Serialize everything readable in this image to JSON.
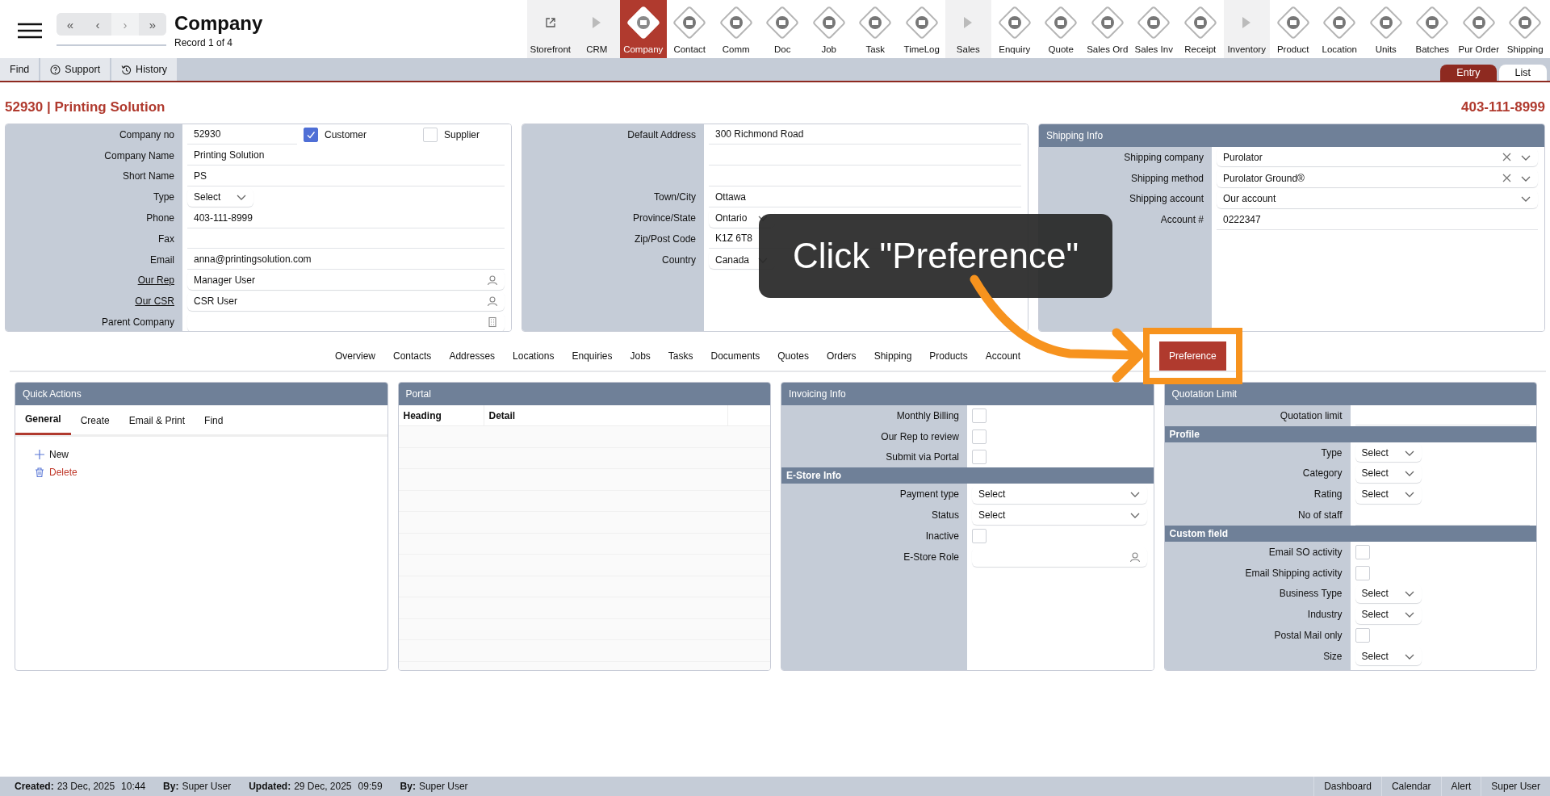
{
  "header": {
    "title": "Company",
    "subtitle": "Record 1 of 4",
    "nav": [
      {
        "glyph": "«",
        "disabled": false
      },
      {
        "glyph": "‹",
        "disabled": false
      },
      {
        "glyph": "›",
        "disabled": true
      },
      {
        "glyph": "»",
        "disabled": false
      }
    ]
  },
  "modules": [
    {
      "label": "Storefront",
      "kind": "link",
      "selected": false
    },
    {
      "label": "CRM",
      "kind": "section",
      "selected": false
    },
    {
      "label": "Company",
      "kind": "module",
      "selected": true
    },
    {
      "label": "Contact",
      "kind": "module",
      "selected": false
    },
    {
      "label": "Comm",
      "kind": "module",
      "selected": false
    },
    {
      "label": "Doc",
      "kind": "module",
      "selected": false
    },
    {
      "label": "Job",
      "kind": "module",
      "selected": false
    },
    {
      "label": "Task",
      "kind": "module",
      "selected": false
    },
    {
      "label": "TimeLog",
      "kind": "module",
      "selected": false
    },
    {
      "label": "Sales",
      "kind": "section",
      "selected": false
    },
    {
      "label": "Enquiry",
      "kind": "module",
      "selected": false
    },
    {
      "label": "Quote",
      "kind": "module",
      "selected": false
    },
    {
      "label": "Sales Ord",
      "kind": "module",
      "selected": false
    },
    {
      "label": "Sales Inv",
      "kind": "module",
      "selected": false
    },
    {
      "label": "Receipt",
      "kind": "module",
      "selected": false
    },
    {
      "label": "Inventory",
      "kind": "section",
      "selected": false
    },
    {
      "label": "Product",
      "kind": "module",
      "selected": false
    },
    {
      "label": "Location",
      "kind": "module",
      "selected": false
    },
    {
      "label": "Units",
      "kind": "module",
      "selected": false
    },
    {
      "label": "Batches",
      "kind": "module",
      "selected": false
    },
    {
      "label": "Pur Order",
      "kind": "module",
      "selected": false
    },
    {
      "label": "Shipping",
      "kind": "module",
      "selected": false
    }
  ],
  "toolbar": {
    "tools": [
      {
        "label": "Find",
        "kind": "plain"
      },
      {
        "label": "Support",
        "kind": "help"
      },
      {
        "label": "History",
        "kind": "history"
      }
    ],
    "views": [
      {
        "label": "Entry",
        "selected": true
      },
      {
        "label": "List",
        "selected": false
      }
    ]
  },
  "record": {
    "title": "52930 | Printing Solution",
    "phone": "403-111-8999"
  },
  "company_panel": {
    "rows": [
      {
        "label": "Company no",
        "kind": "checks",
        "value": "52930",
        "checks": [
          {
            "label": "Customer",
            "checked": true
          },
          {
            "label": "Supplier",
            "checked": false
          }
        ]
      },
      {
        "label": "Company Name",
        "kind": "text",
        "value": "Printing Solution"
      },
      {
        "label": "Short Name",
        "kind": "text",
        "value": "PS"
      },
      {
        "label": "Type",
        "kind": "select",
        "value": "Select"
      },
      {
        "label": "Phone",
        "kind": "text",
        "value": "403-111-8999"
      },
      {
        "label": "Fax",
        "kind": "text"
      },
      {
        "label": "Email",
        "kind": "text",
        "value": "anna@printingsolution.com"
      },
      {
        "label": "Our Rep",
        "kind": "user_lookup",
        "value": "Manager User",
        "link": true
      },
      {
        "label": "Our CSR",
        "kind": "user_lookup",
        "value": "CSR User",
        "link": true
      },
      {
        "label": "Parent Company",
        "kind": "company_lookup"
      }
    ]
  },
  "address_panel": {
    "rows": [
      {
        "label": "Default Address",
        "kind": "text",
        "value": "300 Richmond Road"
      },
      {
        "kind": "text"
      },
      {
        "kind": "text"
      },
      {
        "label": "Town/City",
        "kind": "text",
        "value": "Ottawa"
      },
      {
        "label": "Province/State",
        "kind": "select",
        "value": "Ontario"
      },
      {
        "label": "Zip/Post Code",
        "kind": "text",
        "value": "K1Z 6T8"
      },
      {
        "label": "Country",
        "kind": "select",
        "value": "Canada"
      }
    ]
  },
  "shipping_panel": {
    "title": "Shipping Info",
    "rows": [
      {
        "label": "Shipping company",
        "kind": "combo",
        "value": "Purolator",
        "clearable": true
      },
      {
        "label": "Shipping method",
        "kind": "combo",
        "value": "Purolator Ground®",
        "clearable": true
      },
      {
        "label": "Shipping account",
        "kind": "combo",
        "value": "Our account",
        "clearable": false
      },
      {
        "label": "Account #",
        "kind": "text",
        "value": "0222347"
      }
    ]
  },
  "record_tabs": [
    {
      "label": "Overview",
      "selected": false
    },
    {
      "label": "Contacts",
      "selected": false
    },
    {
      "label": "Addresses",
      "selected": false
    },
    {
      "label": "Locations",
      "selected": false
    },
    {
      "label": "Enquiries",
      "selected": false
    },
    {
      "label": "Jobs",
      "selected": false
    },
    {
      "label": "Tasks",
      "selected": false
    },
    {
      "label": "Documents",
      "selected": false
    },
    {
      "label": "Quotes",
      "selected": false
    },
    {
      "label": "Orders",
      "selected": false
    },
    {
      "label": "Shipping",
      "selected": false
    },
    {
      "label": "Products",
      "selected": false
    },
    {
      "label": "Account",
      "selected": false
    },
    {
      "label": "Preference",
      "selected": true
    }
  ],
  "quick_actions": {
    "title": "Quick Actions",
    "tabs": [
      {
        "label": "General",
        "selected": true
      },
      {
        "label": "Create",
        "selected": false
      },
      {
        "label": "Email & Print",
        "selected": false
      },
      {
        "label": "Find",
        "selected": false
      }
    ],
    "actions": [
      {
        "label": "New",
        "kind": "add"
      },
      {
        "label": "Delete",
        "kind": "delete"
      }
    ]
  },
  "portal": {
    "title": "Portal",
    "columns": [
      "Heading",
      "Detail"
    ]
  },
  "invoicing_panel": {
    "title": "Invoicing Info",
    "rows": [
      {
        "label": "Monthly Billing",
        "kind": "checkbox",
        "checked": false
      },
      {
        "label": "Our Rep to review",
        "kind": "checkbox",
        "checked": false
      },
      {
        "label": "Submit via Portal",
        "kind": "checkbox",
        "checked": false
      },
      {
        "label": "E-Store Info",
        "kind": "section"
      },
      {
        "label": "Payment type",
        "kind": "dropdown",
        "value": "Select"
      },
      {
        "label": "Status",
        "kind": "dropdown",
        "value": "Select"
      },
      {
        "label": "Inactive",
        "kind": "checkbox",
        "checked": false
      },
      {
        "label": "E-Store Role",
        "kind": "user_lookup"
      }
    ]
  },
  "quotation_panel": {
    "title": "Quotation Limit",
    "rows": [
      {
        "label": "Quotation limit",
        "kind": "text"
      },
      {
        "label": "Profile",
        "kind": "section"
      },
      {
        "label": "Type",
        "kind": "select",
        "value": "Select"
      },
      {
        "label": "Category",
        "kind": "select",
        "value": "Select"
      },
      {
        "label": "Rating",
        "kind": "select",
        "value": "Select"
      },
      {
        "label": "No of staff",
        "kind": "text"
      },
      {
        "label": "Custom field",
        "kind": "section"
      },
      {
        "label": "Email SO activity",
        "kind": "checkbox",
        "checked": false
      },
      {
        "label": "Email Shipping activity",
        "kind": "checkbox",
        "checked": false
      },
      {
        "label": "Business Type",
        "kind": "select",
        "value": "Select"
      },
      {
        "label": "Industry",
        "kind": "select",
        "value": "Select"
      },
      {
        "label": "Postal Mail only",
        "kind": "checkbox",
        "checked": false
      },
      {
        "label": "Size",
        "kind": "select",
        "value": "Select"
      }
    ]
  },
  "footer": {
    "items": [
      {
        "label": "Created:",
        "values": [
          "23 Dec, 2025",
          "10:44"
        ]
      },
      {
        "label": "By:",
        "values": [
          "Super User"
        ]
      },
      {
        "label": "Updated:",
        "values": [
          "29 Dec, 2025",
          "09:59"
        ]
      },
      {
        "label": "By:",
        "values": [
          "Super User"
        ]
      }
    ],
    "buttons": [
      "Dashboard",
      "Calendar",
      "Alert",
      "Super User"
    ]
  },
  "overlay": {
    "tooltip": "Click \"Preference\""
  }
}
